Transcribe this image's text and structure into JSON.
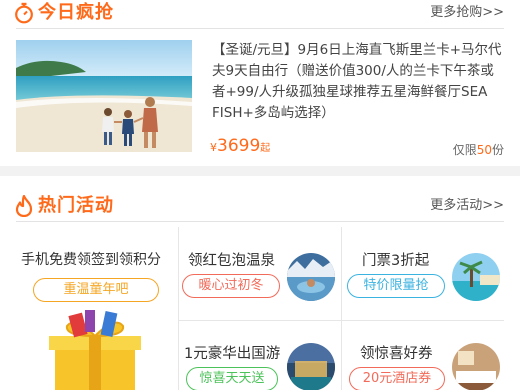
{
  "today_deals": {
    "title": "今日疯抢",
    "more": "更多抢购>>",
    "item": {
      "description": "【圣诞/元旦】9月6日上海直飞斯里兰卡+马尔代夫9天自由行（赠送价值300/人的兰卡下午茶或者+99/人升级孤独星球推荐五星海鲜餐厅SEA FISH+多岛屿选择）",
      "currency": "¥",
      "price": "3699",
      "price_unit": "起",
      "remaining_prefix": "仅限",
      "remaining_count": "50",
      "remaining_suffix": "份"
    }
  },
  "hot_activities": {
    "title": "热门活动",
    "more": "更多活动>>",
    "cells": [
      {
        "title": "手机免费领签到领积分",
        "tag": "重温童年吧",
        "tag_color": "#f5a623"
      },
      {
        "title": "领红包泡温泉",
        "tag": "暖心过初冬",
        "tag_color": "#f26b5a"
      },
      {
        "title": "门票3折起",
        "tag": "特价限量抢",
        "tag_color": "#3bb3e0"
      },
      {
        "title": "1元豪华出国游",
        "tag": "惊喜天天送",
        "tag_color": "#4cc35a"
      },
      {
        "title": "领惊喜好券",
        "tag": "20元酒店券",
        "tag_color": "#f26b5a"
      }
    ]
  },
  "colors": {
    "accent": "#ff6a1a",
    "divider": "#e3e3e3"
  }
}
